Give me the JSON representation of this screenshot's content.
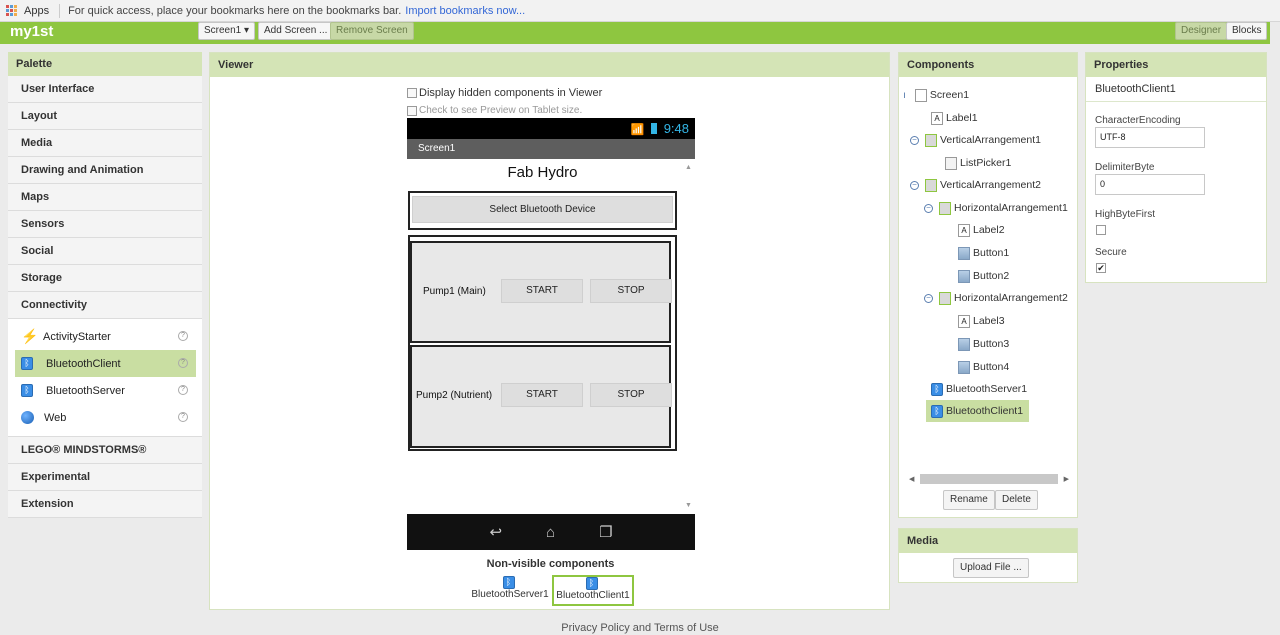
{
  "bookmarks": {
    "apps": "Apps",
    "hint": "For quick access, place your bookmarks here on the bookmarks bar.",
    "import_link": "Import bookmarks now..."
  },
  "topbar": {
    "title": "my1st",
    "screen_select": "Screen1 ▾",
    "add_screen": "Add Screen ...",
    "remove_screen": "Remove Screen",
    "designer": "Designer",
    "blocks": "Blocks"
  },
  "palette": {
    "title": "Palette",
    "categories_top": [
      "User Interface",
      "Layout",
      "Media",
      "Drawing and Animation",
      "Maps",
      "Sensors",
      "Social",
      "Storage",
      "Connectivity"
    ],
    "items": [
      {
        "label": "ActivityStarter",
        "icon": "lightning-icon"
      },
      {
        "label": "BluetoothClient",
        "icon": "bluetooth-icon"
      },
      {
        "label": "BluetoothServer",
        "icon": "bluetooth-icon"
      },
      {
        "label": "Web",
        "icon": "globe-icon"
      }
    ],
    "categories_bottom": [
      "LEGO® MINDSTORMS®",
      "Experimental",
      "Extension"
    ]
  },
  "viewer": {
    "title": "Viewer",
    "display_hidden": "Display hidden components in Viewer",
    "tablet_preview": "Check to see Preview on Tablet size.",
    "phone": {
      "time": "9:48",
      "screen_title": "Screen1",
      "app_heading": "Fab Hydro",
      "select_device": "Select Bluetooth Device",
      "pump1_label": "Pump1 (Main)",
      "pump2_label": "Pump2 (Nutrient)",
      "start": "START",
      "stop": "STOP"
    },
    "nonvisible_title": "Non-visible components",
    "nonvisible": [
      "BluetoothServer1",
      "BluetoothClient1"
    ]
  },
  "components": {
    "title": "Components",
    "tree": [
      {
        "label": "Screen1",
        "icon": "screen"
      },
      {
        "label": "Label1",
        "icon": "label"
      },
      {
        "label": "VerticalArrangement1",
        "icon": "va"
      },
      {
        "label": "ListPicker1",
        "icon": "lp"
      },
      {
        "label": "VerticalArrangement2",
        "icon": "va"
      },
      {
        "label": "HorizontalArrangement1",
        "icon": "ha"
      },
      {
        "label": "Label2",
        "icon": "label"
      },
      {
        "label": "Button1",
        "icon": "btn"
      },
      {
        "label": "Button2",
        "icon": "btn"
      },
      {
        "label": "HorizontalArrangement2",
        "icon": "ha"
      },
      {
        "label": "Label3",
        "icon": "label"
      },
      {
        "label": "Button3",
        "icon": "btn"
      },
      {
        "label": "Button4",
        "icon": "btn"
      },
      {
        "label": "BluetoothServer1",
        "icon": "bt"
      },
      {
        "label": "BluetoothClient1",
        "icon": "bt"
      }
    ],
    "rename": "Rename",
    "delete": "Delete"
  },
  "media": {
    "title": "Media",
    "upload": "Upload File ..."
  },
  "properties": {
    "title": "Properties",
    "component": "BluetoothClient1",
    "character_encoding_label": "CharacterEncoding",
    "character_encoding_value": "UTF-8",
    "delimiter_label": "DelimiterByte",
    "delimiter_value": "0",
    "high_byte_label": "HighByteFirst",
    "high_byte_checked": false,
    "secure_label": "Secure",
    "secure_checked": true
  },
  "footer": "Privacy Policy and Terms of Use"
}
